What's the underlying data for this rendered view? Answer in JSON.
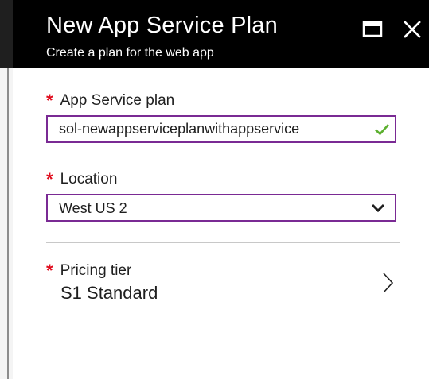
{
  "header": {
    "title": "New App Service Plan",
    "subtitle": "Create a plan for the web app",
    "maximize_icon": "maximize-icon",
    "close_icon": "close-icon",
    "background": "#000000"
  },
  "required_marker": "*",
  "app_service_plan": {
    "label": "App Service plan",
    "value": "sol-newappserviceplanwithappservice",
    "valid": true
  },
  "location": {
    "label": "Location",
    "selected": "West US 2"
  },
  "pricing_tier": {
    "label": "Pricing tier",
    "value": "S1 Standard"
  },
  "colors": {
    "required": "#e00b1c",
    "focus_border": "#7a2a94",
    "valid_check": "#5cb02f"
  }
}
